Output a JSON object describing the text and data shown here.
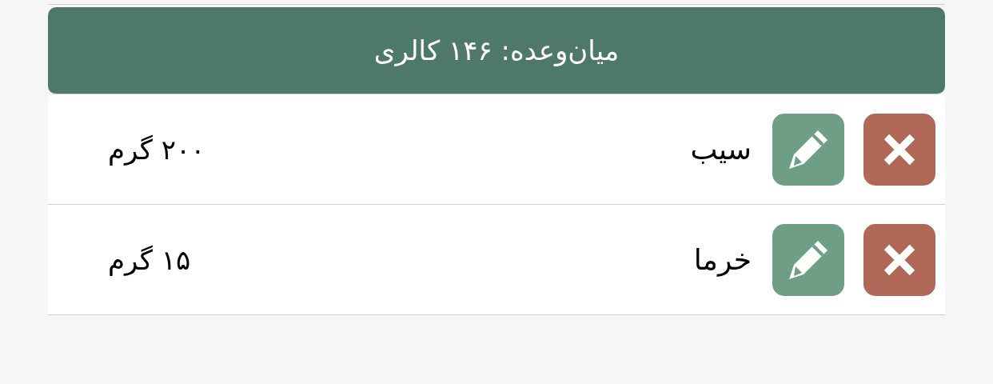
{
  "header": {
    "title": "میان‌وعده: ۱۴۶ کالری"
  },
  "items": [
    {
      "name": "سیب",
      "amount": "۲۰۰ گرم"
    },
    {
      "name": "خرما",
      "amount": "۱۵ گرم"
    }
  ]
}
